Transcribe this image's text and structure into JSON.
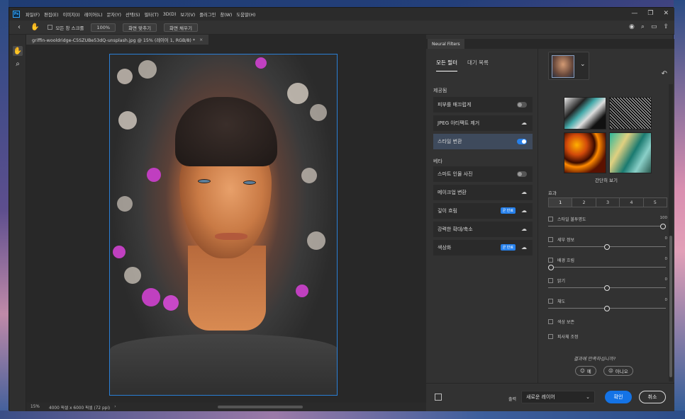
{
  "app": {
    "logo": "Ps",
    "menu": [
      "파일(F)",
      "편집(E)",
      "이미지(I)",
      "레이어(L)",
      "문자(Y)",
      "선택(S)",
      "필터(T)",
      "3D(D)",
      "보기(V)",
      "플러그인",
      "창(W)",
      "도움말(H)"
    ],
    "window_controls": [
      "—",
      "❐",
      "✕"
    ]
  },
  "options_bar": {
    "scroll_all_label": "모든 창 스크롤",
    "zoom_100": "100%",
    "fit_screen": "화면 맞추기",
    "fill_screen": "화면 채우기"
  },
  "document": {
    "tab_title": "griffin-wooldridge-C5SZUBe53dQ-unsplash.jpg @ 15% (레이어 1, RGB/8) *",
    "tab_close": "×"
  },
  "status": {
    "zoom": "15%",
    "info": "4000 픽셀 x 6000 픽셀 (72 ppi)",
    "arrow": "›"
  },
  "neural_filters": {
    "panel_tab": "Neural Filters",
    "tabs": [
      "모든 필터",
      "대기 목록"
    ],
    "featured_label": "제공됨",
    "featured": [
      {
        "label": "피부를 매끄럽게",
        "control": "toggle-off"
      },
      {
        "label": "JPEG 아티팩트 제거",
        "control": "cloud"
      },
      {
        "label": "스타일 변환",
        "control": "toggle-on"
      }
    ],
    "beta_label": "베타",
    "beta": [
      {
        "label": "스마트 인물 사진",
        "control": "toggle-off"
      },
      {
        "label": "메이크업 변환",
        "control": "cloud"
      },
      {
        "label": "깊이 흐림",
        "control": "cloud",
        "badge": "곧 만료"
      },
      {
        "label": "강력한 확대/축소",
        "control": "cloud"
      },
      {
        "label": "색상화",
        "control": "cloud",
        "badge": "곧 만료"
      }
    ],
    "easy_view": "간단히 보기",
    "effect_label": "효과",
    "effect_levels": [
      "1",
      "2",
      "3",
      "4",
      "5"
    ],
    "options": [
      {
        "label": "스타일 불투명도",
        "value": "100",
        "slider": 1.0
      },
      {
        "label": "세부 정보",
        "value": "0",
        "slider": 0.5
      },
      {
        "label": "배경 흐림",
        "value": "0",
        "slider": 0.0
      },
      {
        "label": "밝기",
        "value": "0",
        "slider": 0.5
      },
      {
        "label": "채도",
        "value": "0",
        "slider": 0.5
      }
    ],
    "checkbox_only": [
      "색상 보존",
      "피사체 조정"
    ],
    "satisfied": "결과에 만족하십니까?",
    "yes": "예",
    "no": "아니오",
    "output_label": "출력",
    "output_value": "새로운 레이어",
    "ok": "확인",
    "cancel": "취소"
  },
  "colors": {
    "accent": "#2680eb",
    "ok_button": "#1473e6",
    "selection_border": "#2a7fd6"
  }
}
